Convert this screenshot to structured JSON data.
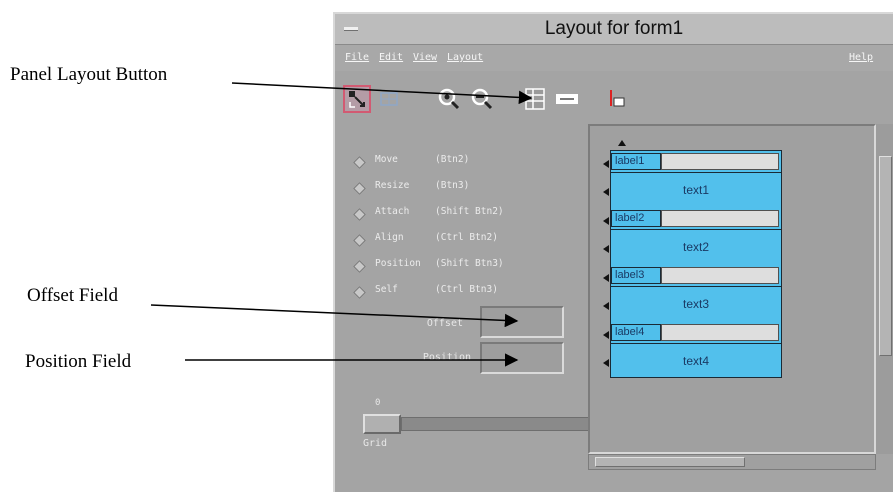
{
  "callouts": {
    "panel_layout": "Panel Layout Button",
    "offset": "Offset Field",
    "position": "Position Field"
  },
  "window": {
    "title": "Layout for form1"
  },
  "menubar": {
    "file": "File",
    "edit": "Edit",
    "view": "View",
    "layout": "Layout",
    "help": "Help"
  },
  "toolbar": {
    "icons": [
      "layout-pointer-icon",
      "grid-icon",
      "zoom-in-icon",
      "zoom-out-icon",
      "panel-layout-icon",
      "dialog-icon",
      "attach-icon"
    ]
  },
  "modes": [
    {
      "label": "Move",
      "shortcut": "(Btn2)"
    },
    {
      "label": "Resize",
      "shortcut": "(Btn3)"
    },
    {
      "label": "Attach",
      "shortcut": "(Shift Btn2)"
    },
    {
      "label": "Align",
      "shortcut": "(Ctrl Btn2)"
    },
    {
      "label": "Position",
      "shortcut": "(Shift Btn3)"
    },
    {
      "label": "Self",
      "shortcut": "(Ctrl Btn3)"
    }
  ],
  "fields": {
    "offset_label": "Offset",
    "position_label": "Position"
  },
  "grid": {
    "label": "Grid",
    "value": "0"
  },
  "form_rows": [
    {
      "label": "label1",
      "text": "text1"
    },
    {
      "label": "label2",
      "text": "text2"
    },
    {
      "label": "label3",
      "text": "text3"
    },
    {
      "label": "label4",
      "text": "text4"
    }
  ],
  "colors": {
    "window_bg": "#a4a4a4",
    "form_fill": "#52c0ec",
    "label_field": "#dedede",
    "active_tool": "#d25a72"
  }
}
